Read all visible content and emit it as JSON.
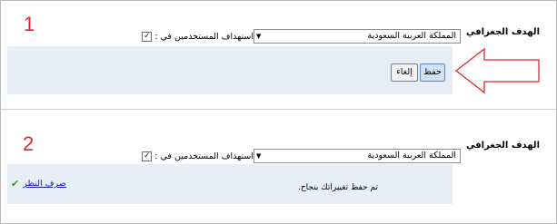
{
  "section1": {
    "step_number": "1",
    "label": "الهدف الجغرافي",
    "checkbox_checked": true,
    "checkbox_label": "استهداف المستخدمين في :",
    "country_value": "المملكة العربية السعودية",
    "save_label": "حفظ",
    "cancel_label": "إلغاء"
  },
  "section2": {
    "step_number": "2",
    "label": "الهدف الجغرافي",
    "checkbox_checked": true,
    "checkbox_label": "استهداف المستخدمين في :",
    "country_value": "المملكة العربية السعودية",
    "success_message": "تم حفظ تغييراتك بنجاح.",
    "dismiss_label": "صرف النظر"
  },
  "colors": {
    "step_number": "#e4242f",
    "arrow": "#e4242f",
    "panel_bg": "#e8eef7",
    "link": "#1a1aa6",
    "check": "#3a9a2a"
  }
}
